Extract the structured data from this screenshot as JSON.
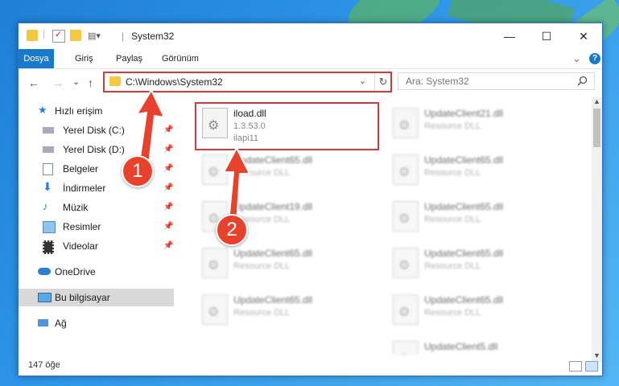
{
  "window": {
    "title": "System32",
    "minimize": "—",
    "maximize": "☐",
    "close": "✕"
  },
  "ribbon": {
    "tabs": [
      "Dosya",
      "Giriş",
      "Paylaş",
      "Görünüm"
    ],
    "collapse": "⌄",
    "help": "?"
  },
  "address": {
    "back": "←",
    "forward": "→",
    "recent": "⌄",
    "up": "↑",
    "path": "C:\\Windows\\System32",
    "dropdown": "⌄",
    "refresh": "↻"
  },
  "search": {
    "placeholder": "Ara: System32",
    "icon": "search-icon"
  },
  "navigation": {
    "items": [
      {
        "label": "Hızlı erişim",
        "icon": "star-icon",
        "pinned": false
      },
      {
        "label": "Yerel Disk (C:)",
        "icon": "drive-icon",
        "pinned": true
      },
      {
        "label": "Yerel Disk (D:)",
        "icon": "drive-icon",
        "pinned": true
      },
      {
        "label": "Belgeler",
        "icon": "documents-icon",
        "pinned": true
      },
      {
        "label": "İndirmeler",
        "icon": "download-icon",
        "pinned": true
      },
      {
        "label": "Müzik",
        "icon": "music-icon",
        "pinned": true
      },
      {
        "label": "Resimler",
        "icon": "pictures-icon",
        "pinned": true
      },
      {
        "label": "Videolar",
        "icon": "video-icon",
        "pinned": true
      },
      {
        "label": "OneDrive",
        "icon": "cloud-icon",
        "pinned": false
      },
      {
        "label": "Bu bilgisayar",
        "icon": "computer-icon",
        "pinned": false,
        "selected": true
      },
      {
        "label": "Ağ",
        "icon": "network-icon",
        "pinned": false
      }
    ],
    "pin_glyph": "📌"
  },
  "files": {
    "highlighted": {
      "name": "iload.dll",
      "version": "1.3.53.0",
      "desc": "ilapi11"
    },
    "blurred": [
      {
        "name": "UpdateClient21.dll",
        "desc": "Resource DLL"
      },
      {
        "name": "UpdateClient65.dll",
        "desc": "Resource DLL"
      },
      {
        "name": "UpdateClient65.dll",
        "desc": "Resource DLL"
      },
      {
        "name": "UpdateClient19.dll",
        "desc": "Resource DLL"
      },
      {
        "name": "UpdateClient65.dll",
        "desc": "Resource DLL"
      },
      {
        "name": "UpdateClient65.dll",
        "desc": "Resource DLL"
      },
      {
        "name": "UpdateClient65.dll",
        "desc": "Resource DLL"
      },
      {
        "name": "UpdateClient65.dll",
        "desc": "Resource DLL"
      },
      {
        "name": "UpdateClient65.dll",
        "desc": "Resource DLL"
      },
      {
        "name": "UpdateClient5.dll",
        "desc": "Resource DLL"
      }
    ]
  },
  "status": {
    "count": "147 öğe"
  },
  "callouts": [
    "1",
    "2"
  ],
  "colors": {
    "accent": "#1979ca",
    "highlight": "#d23b3b",
    "callout": "#e8412c"
  }
}
